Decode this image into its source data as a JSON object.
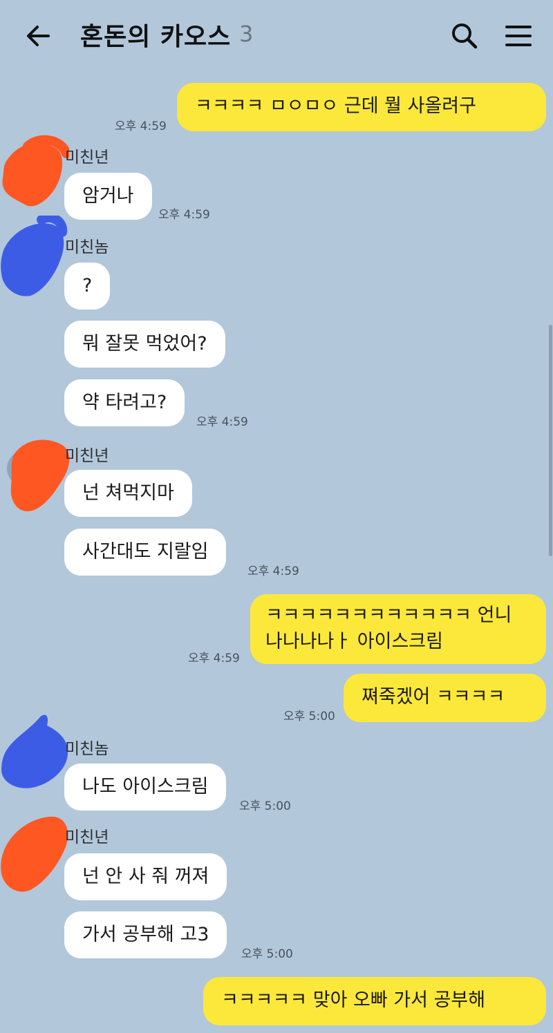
{
  "header": {
    "title": "혼돈의 카오스",
    "member_count": "3",
    "back_icon": "arrow-left-icon",
    "search_icon": "search-icon",
    "menu_icon": "hamburger-menu-icon"
  },
  "colors": {
    "background": "#b2c7da",
    "my_bubble": "#fce83a",
    "their_bubble": "#ffffff",
    "censor_orange": "#ff5722",
    "censor_blue": "#3d5ce6"
  },
  "messages": {
    "m1": {
      "text": "ㅋㅋㅋㅋ ㅁㅇㅁㅇ 근데 뭘 사올려구",
      "time": "오후 4:59"
    },
    "g1": {
      "sender": "미친년",
      "m1": "암거나",
      "time": "오후 4:59"
    },
    "g2": {
      "sender": "미친놈",
      "m1": "?",
      "m2": "뭐 잘못 먹었어?",
      "m3": "약 타려고?",
      "time": "오후 4:59"
    },
    "g3": {
      "sender": "미친년",
      "m1": "넌 쳐먹지마",
      "m2": "사간대도 지랄임",
      "time": "오후 4:59"
    },
    "m2": {
      "line1": "ㅋㅋㅋㅋㅋㅋㅋㅋㅋㅋㅋㅋ 언니",
      "line2": "나나나나ㅏ 아이스크림",
      "time": "오후 4:59"
    },
    "m3": {
      "text": "쪄죽겠어 ㅋㅋㅋㅋ",
      "time": "오후 5:00"
    },
    "g4": {
      "sender": "미친놈",
      "m1": "나도 아이스크림",
      "time": "오후 5:00"
    },
    "g5": {
      "sender": "미친년",
      "m1": "넌 안 사 줘 꺼져",
      "m2": "가서 공부해 고3",
      "time": "오후 5:00"
    },
    "m4": {
      "text": "ㅋㅋㅋㅋㅋ 맞아 오빠 가서 공부해"
    }
  }
}
